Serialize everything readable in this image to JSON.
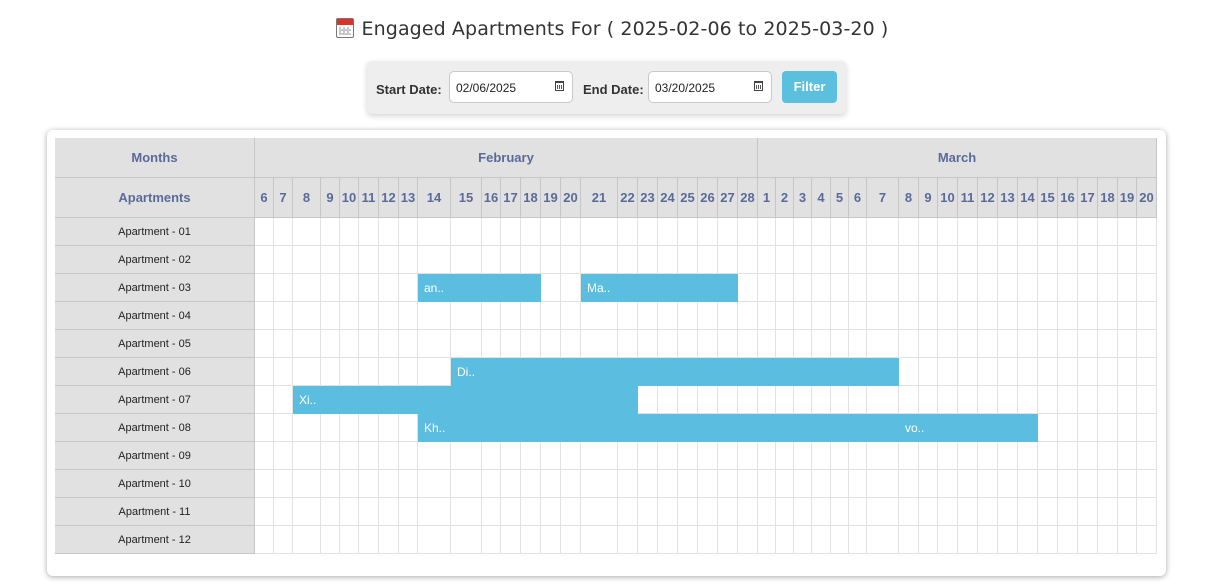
{
  "title": "Engaged Apartments For ( 2025-02-06 to 2025-03-20 )",
  "title_icon": "calendar-icon",
  "filter": {
    "start_label": "Start Date:",
    "start_value": "02/06/2025",
    "end_label": "End Date:",
    "end_value": "03/20/2025",
    "button_label": "Filter"
  },
  "table": {
    "months_header": "Months",
    "apartments_header": "Apartments",
    "months": [
      {
        "name": "February",
        "days": [
          "6",
          "7",
          "8",
          "9",
          "10",
          "11",
          "12",
          "13",
          "14",
          "15",
          "16",
          "17",
          "18",
          "19",
          "20",
          "21",
          "22",
          "23",
          "24",
          "25",
          "26",
          "27",
          "28"
        ]
      },
      {
        "name": "March",
        "days": [
          "1",
          "2",
          "3",
          "4",
          "5",
          "6",
          "7",
          "8",
          "9",
          "10",
          "11",
          "12",
          "13",
          "14",
          "15",
          "16",
          "17",
          "18",
          "19",
          "20"
        ]
      }
    ],
    "apartments": [
      "Apartment - 01",
      "Apartment - 02",
      "Apartment - 03",
      "Apartment - 04",
      "Apartment - 05",
      "Apartment - 06",
      "Apartment - 07",
      "Apartment - 08",
      "Apartment - 09",
      "Apartment - 10",
      "Apartment - 11",
      "Apartment - 12"
    ],
    "bookings": [
      {
        "apartment": "Apartment - 03",
        "start": "2025-02-14",
        "end": "2025-02-19",
        "label": "an.."
      },
      {
        "apartment": "Apartment - 03",
        "start": "2025-02-21",
        "end": "2025-02-28",
        "label": "Ma.."
      },
      {
        "apartment": "Apartment - 06",
        "start": "2025-02-15",
        "end": "2025-03-08",
        "label": "Di.."
      },
      {
        "apartment": "Apartment - 07",
        "start": "2025-02-08",
        "end": "2025-02-23",
        "label": "Xi.."
      },
      {
        "apartment": "Apartment - 08",
        "start": "2025-02-14",
        "end": "2025-03-08",
        "label": "Kh.."
      },
      {
        "apartment": "Apartment - 08",
        "start": "2025-03-08",
        "end": "2025-03-15",
        "label": "vo.."
      }
    ],
    "colors": {
      "bar": "#5bbde0",
      "header_bg": "#e1e1e1",
      "header_text": "#5a6b9a"
    }
  }
}
